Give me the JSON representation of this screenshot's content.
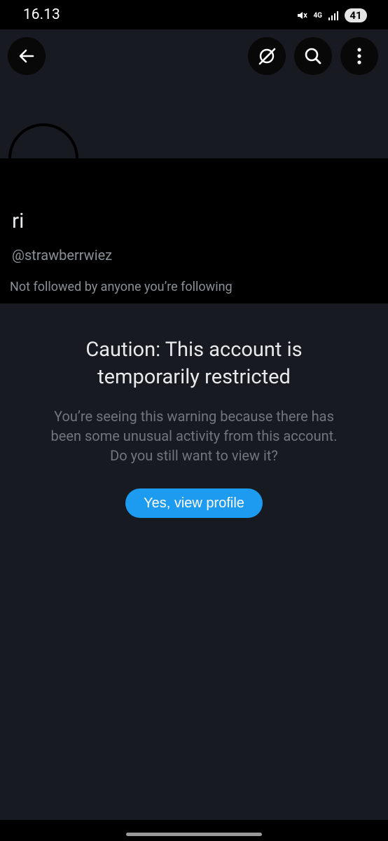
{
  "status_bar": {
    "time": "16.13",
    "network": "4G",
    "battery": "41"
  },
  "header": {
    "back_icon": "arrow-left-icon",
    "grok_icon": "grok-icon",
    "search_icon": "search-icon",
    "more_icon": "more-vertical-icon"
  },
  "profile": {
    "display_name": "ri",
    "handle": "@strawberrwiez",
    "followers_note": "Not followed by anyone you’re following"
  },
  "caution": {
    "title_line1": "Caution: This account is",
    "title_line2": "temporarily restricted",
    "body_line1": "You’re seeing this warning because there has",
    "body_line2": "been some unusual activity from this account.",
    "body_line3": "Do you still want to view it?",
    "button_label": "Yes, view profile"
  },
  "colors": {
    "background": "#171a20",
    "accent": "#1d9bf0",
    "secondary_text": "#71767b"
  }
}
